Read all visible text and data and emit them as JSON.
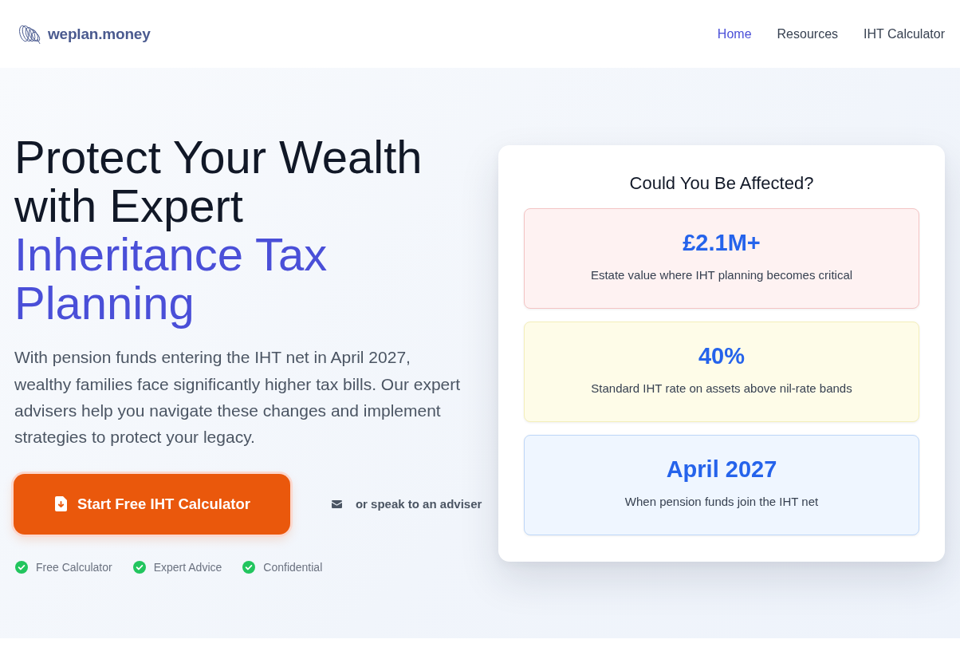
{
  "header": {
    "logo": {
      "text": "weplan.money"
    },
    "nav": [
      {
        "label": "Home",
        "selected": true
      },
      {
        "label": "Resources",
        "selected": false
      },
      {
        "label": "IHT Calculator",
        "selected": false
      }
    ]
  },
  "hero": {
    "heading": {
      "text": "Protect Your Wealth with Expert",
      "highlight": "Inheritance Tax Planning"
    },
    "description": "With pension funds entering the IHT net in April 2027, wealthy families face significantly higher tax bills. Our expert advisers help you navigate these changes and implement strategies to protect your legacy.",
    "primary_button": {
      "label": "Start Free IHT Calculator"
    },
    "secondary_link": {
      "label": "or speak to an adviser"
    },
    "features": [
      "Free Calculator",
      "Expert Advice",
      "Confidential"
    ]
  },
  "stats_card": {
    "title": "Could You Be Affected?",
    "stats": [
      {
        "value": "£2.1M+",
        "label": "Estate value where IHT planning becomes critical",
        "color": "#fef2f2"
      },
      {
        "value": "40%",
        "label": "Standard IHT rate on assets above nil-rate bands",
        "color": "#fefce8"
      },
      {
        "value": "April 2027",
        "label": "When pension funds join the IHT net",
        "color": "#eff6ff"
      }
    ]
  }
}
